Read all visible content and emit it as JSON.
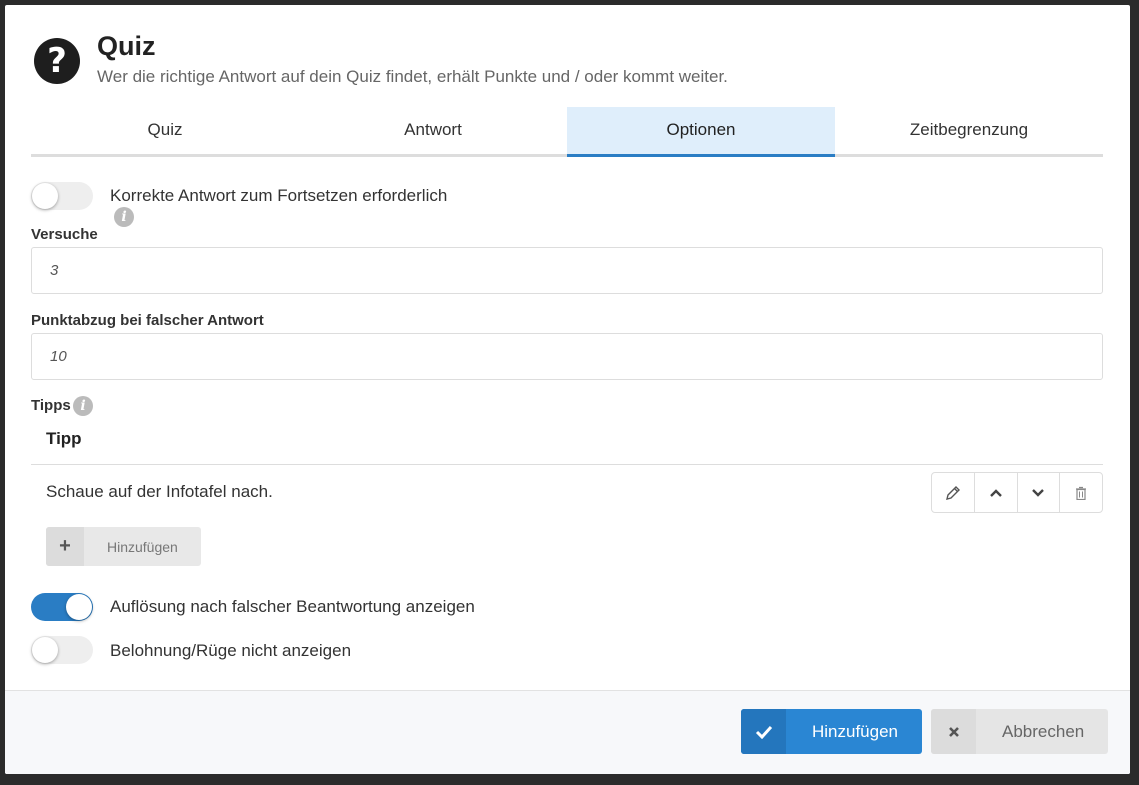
{
  "dialog": {
    "title": "Quiz",
    "subtitle": "Wer die richtige Antwort auf dein Quiz findet, erhält Punkte und / oder kommt weiter.",
    "help_icon": "question-circle-icon"
  },
  "tabs": [
    {
      "label": "Quiz",
      "active": false
    },
    {
      "label": "Antwort",
      "active": false
    },
    {
      "label": "Optionen",
      "active": true
    },
    {
      "label": "Zeitbegrenzung",
      "active": false
    }
  ],
  "options": {
    "require_correct": {
      "label": "Korrekte Antwort zum Fortsetzen erforderlich",
      "on": false
    },
    "attempts": {
      "label": "Versuche",
      "value": "3"
    },
    "penalty": {
      "label": "Punktabzug bei falscher Antwort",
      "value": "10"
    },
    "tips": {
      "label": "Tipps",
      "column_header": "Tipp",
      "rows": [
        "Schaue auf der Infotafel nach."
      ],
      "add_label": "Hinzufügen"
    },
    "show_solution": {
      "label": "Auflösung nach falscher Beantwortung anzeigen",
      "on": true
    },
    "hide_reward": {
      "label": "Belohnung/Rüge nicht anzeigen",
      "on": false
    }
  },
  "footer": {
    "submit_label": "Hinzufügen",
    "cancel_label": "Abbrechen"
  },
  "colors": {
    "accent": "#2a86d3",
    "active_tab_bg": "#dfeefb"
  }
}
